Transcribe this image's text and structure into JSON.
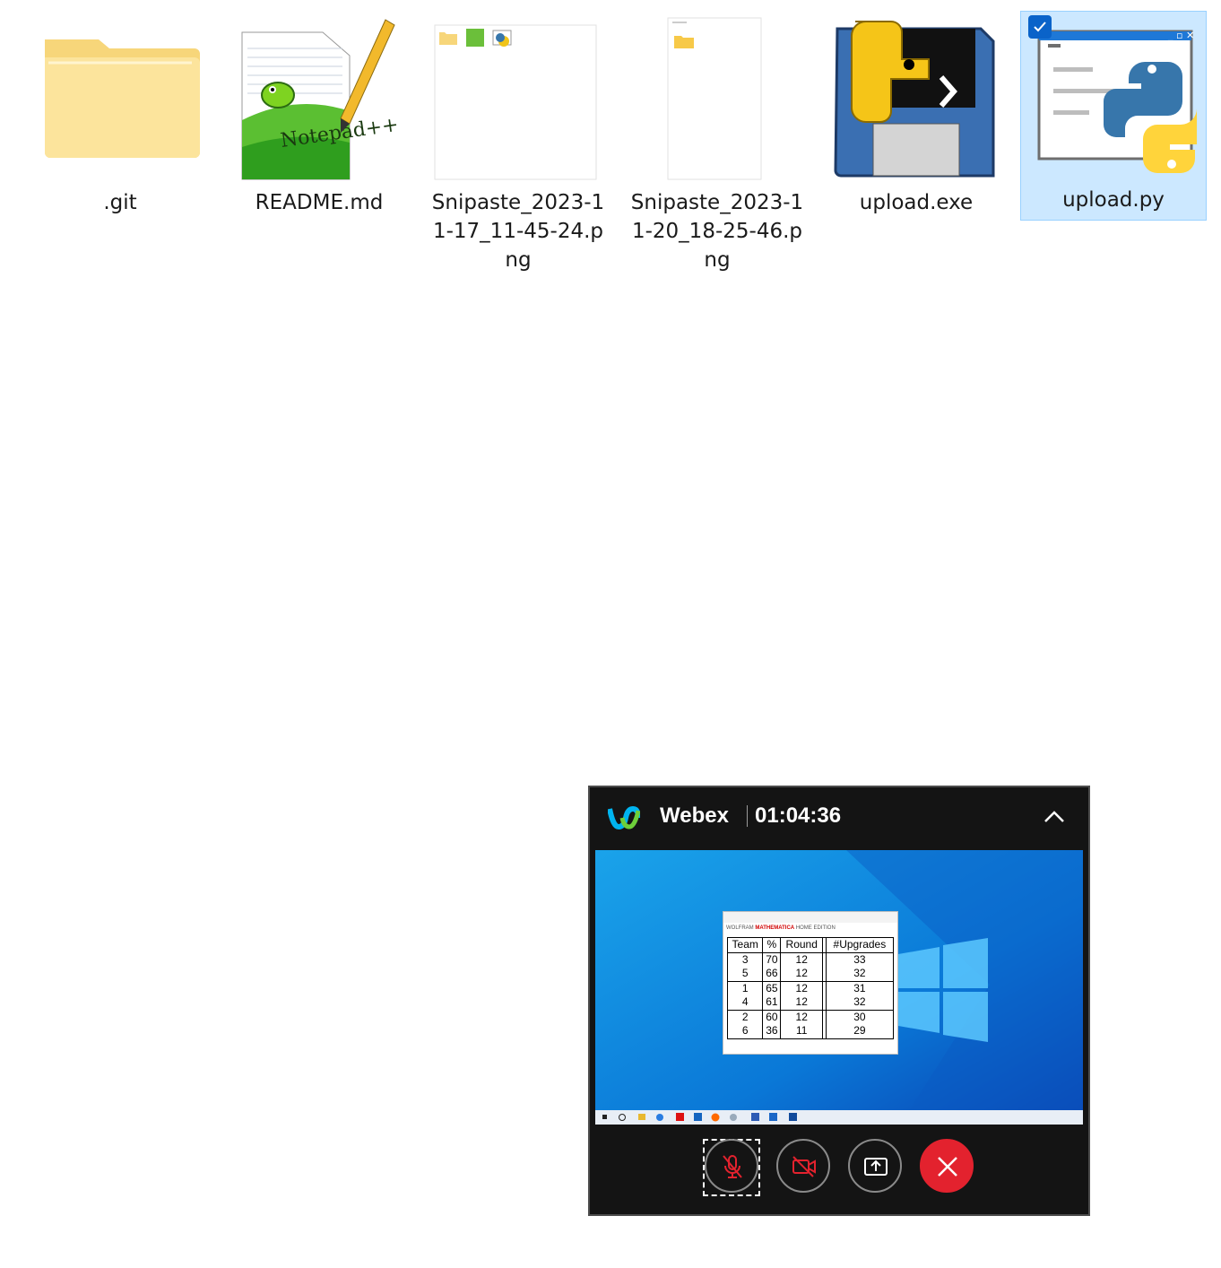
{
  "files": [
    {
      "name": ".git",
      "icon": "folder-icon",
      "selected": false
    },
    {
      "name": "README.md",
      "icon": "notepad-plus-plus-icon",
      "selected": false
    },
    {
      "name": "Snipaste_2023-11-17_11-45-24.png",
      "icon": "image-thumbnail-icon",
      "selected": false
    },
    {
      "name": "Snipaste_2023-11-20_18-25-46.png",
      "icon": "image-thumbnail-icon",
      "selected": false
    },
    {
      "name": "upload.exe",
      "icon": "python-launcher-icon",
      "selected": false
    },
    {
      "name": "upload.py",
      "icon": "python-file-icon",
      "selected": true
    }
  ],
  "webex": {
    "title": "Webex",
    "timer": "01:04:36",
    "shared_table": {
      "brand_prefix": "WOLFRAM",
      "brand_name": "MATHEMATICA",
      "brand_suffix": "HOME EDITION",
      "headers": [
        "Team",
        "%",
        "Round",
        "",
        "#Upgrades"
      ],
      "rows": [
        [
          "3",
          "70",
          "12",
          "",
          "33"
        ],
        [
          "5",
          "66",
          "12",
          "",
          "32"
        ],
        [
          "1",
          "65",
          "12",
          "",
          "31"
        ],
        [
          "4",
          "61",
          "12",
          "",
          "32"
        ],
        [
          "2",
          "60",
          "12",
          "",
          "30"
        ],
        [
          "6",
          "36",
          "11",
          "",
          "29"
        ]
      ]
    },
    "controls": [
      "mute-microphone",
      "stop-video",
      "share-screen",
      "end-meeting"
    ]
  },
  "colors": {
    "selection": "#cce8ff",
    "webex_bg": "#141414",
    "end_red": "#e3222e",
    "mute_red": "#e3222e",
    "desktop_blue": "#0a78d7"
  }
}
